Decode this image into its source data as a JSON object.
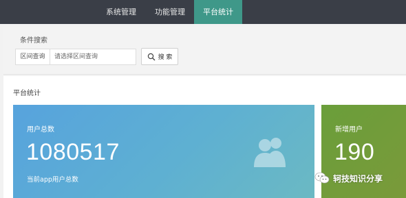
{
  "topnav": {
    "tabs": [
      {
        "label": "系统管理"
      },
      {
        "label": "功能管理"
      },
      {
        "label": "平台统计"
      }
    ],
    "active_color": "#3f9889"
  },
  "search": {
    "title": "条件搜索",
    "field_label": "区间查询",
    "field_placeholder": "请选择区间查询",
    "button_label": "搜 索"
  },
  "stats": {
    "title": "平台统计",
    "cards": [
      {
        "label": "用户总数",
        "value": "1080517",
        "sub": "当前app用户总数",
        "icon": "users-icon",
        "color": "#57a3dd"
      },
      {
        "label": "新增用户",
        "value": "190",
        "color": "#6a9e3a"
      }
    ]
  },
  "watermark": {
    "text": "轲技知识分享",
    "icon": "wechat-icon"
  }
}
